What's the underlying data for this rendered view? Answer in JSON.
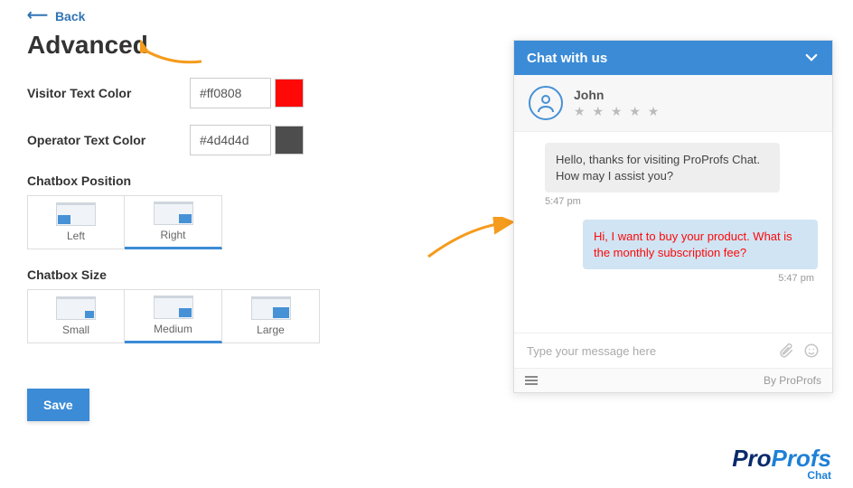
{
  "back_label": "Back",
  "page_title": "Advanced",
  "visitor_color": {
    "label": "Visitor Text Color",
    "value": "#ff0808"
  },
  "operator_color": {
    "label": "Operator Text Color",
    "value": "#4d4d4d"
  },
  "position": {
    "label": "Chatbox Position",
    "options": [
      "Left",
      "Right"
    ],
    "selected": "Right"
  },
  "size": {
    "label": "Chatbox Size",
    "options": [
      "Small",
      "Medium",
      "Large"
    ],
    "selected": "Medium"
  },
  "save_label": "Save",
  "chat": {
    "header": "Chat with us",
    "operator_name": "John",
    "messages": [
      {
        "from": "operator",
        "text": "Hello, thanks for visiting ProProfs Chat. How may I assist you?",
        "time": "5:47 pm"
      },
      {
        "from": "visitor",
        "text": "Hi, I want to buy your product. What is the monthly subscription fee?",
        "time": "5:47 pm"
      }
    ],
    "input_placeholder": "Type your message here",
    "footer": "By ProProfs"
  },
  "brand": {
    "name_a": "Pro",
    "name_b": "Profs",
    "sub": "Chat"
  }
}
